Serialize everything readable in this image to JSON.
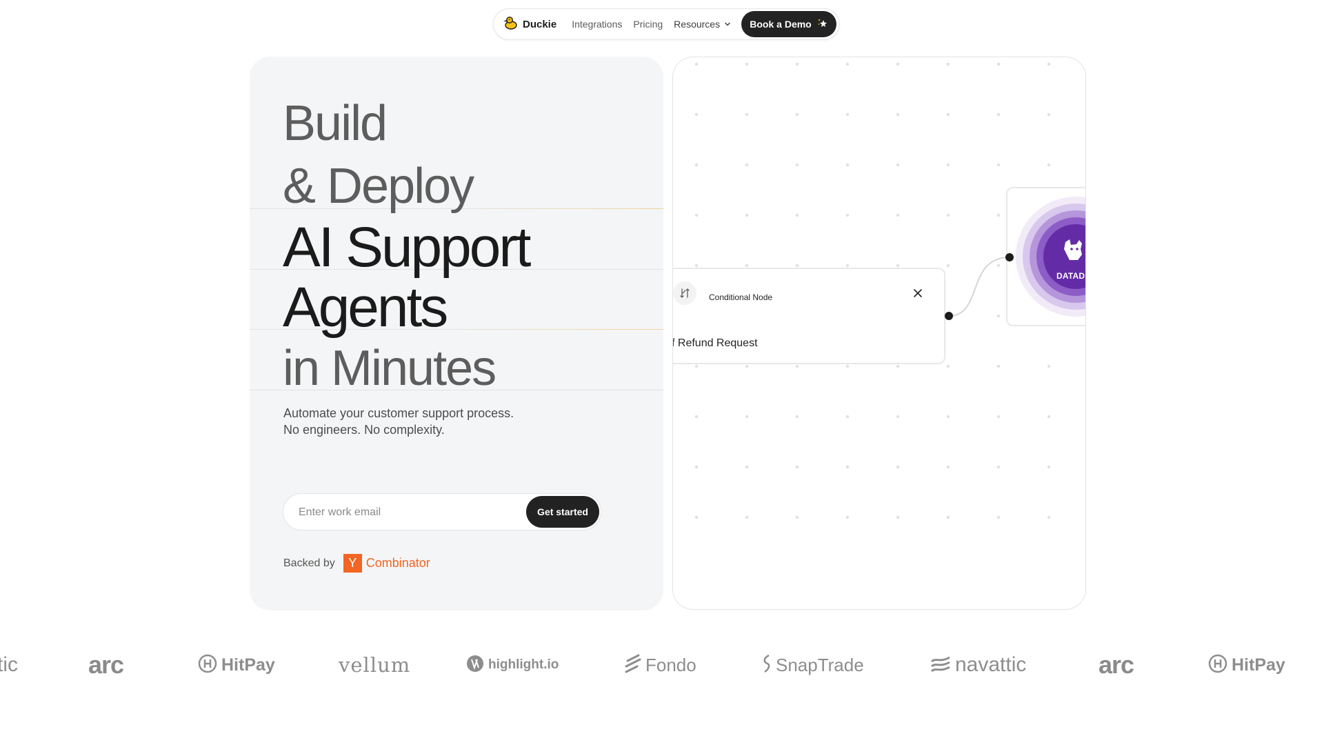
{
  "nav": {
    "brand": "Duckie",
    "links": [
      "Integrations",
      "Pricing"
    ],
    "resources_label": "Resources",
    "demo_label": "Book a Demo"
  },
  "hero": {
    "line1": "Build",
    "line2": "& Deploy",
    "line3": "AI Support",
    "line4": "Agents",
    "line5": "in Minutes",
    "sub1": "Automate your customer support process.",
    "sub2": "No engineers. No complexity.",
    "email_placeholder": "Enter work email",
    "cta_label": "Get started",
    "backed_by": "Backed by",
    "yc_letter": "Y",
    "yc_word": "Combinator"
  },
  "canvas": {
    "node_title": "Conditional Node",
    "node_condition": "f Refund Request",
    "integration_label": "DATAD"
  },
  "logos": [
    "tic",
    "arc",
    "HitPay",
    "vellum",
    "highlight.io",
    "Fondo",
    "SnapTrade",
    "navattic",
    "arc",
    "HitPay"
  ],
  "colors": {
    "accent_orange": "#f26522",
    "dark_button": "#232323",
    "datadog_purple": "#632ca6",
    "divider_gold": "#f0d49a"
  }
}
